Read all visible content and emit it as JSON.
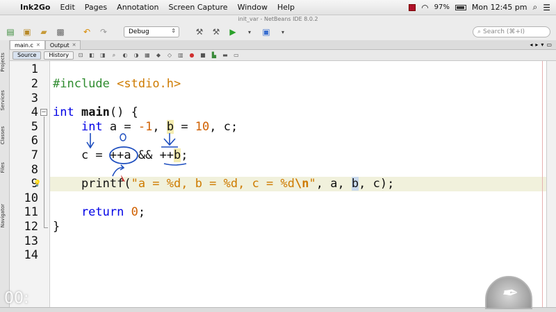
{
  "menubar": {
    "app_name": "Ink2Go",
    "items": [
      "Edit",
      "Pages",
      "Annotation",
      "Screen Capture",
      "Window",
      "Help"
    ],
    "battery": "97%",
    "clock": "Mon 12:45 pm"
  },
  "window": {
    "title": "init_var - NetBeans IDE 8.0.2"
  },
  "toolbar": {
    "config_value": "Debug",
    "search_placeholder": "Search (⌘+I)"
  },
  "sidebar": {
    "tabs": [
      "Projects",
      "Services",
      "Classes",
      "Files",
      "Navigator"
    ]
  },
  "editor_tabs": [
    {
      "label": "main.c"
    },
    {
      "label": "Output"
    }
  ],
  "subbar": {
    "source_label": "Source",
    "history_label": "History"
  },
  "line_numbers": [
    "1",
    "2",
    "3",
    "4",
    "5",
    "6",
    "7",
    "8",
    "9",
    "10",
    "11",
    "12",
    "13",
    "14"
  ],
  "code": {
    "line2": {
      "directive": "#include",
      "header": "<stdio.h>"
    },
    "line4": {
      "kw": "int",
      "name": "main",
      "rest": "() {"
    },
    "line5": {
      "indent": "    ",
      "kw": "int",
      "a": " a = ",
      "neg": "-1",
      "comma": ", ",
      "b": "b",
      "eq": " = ",
      "ten": "10",
      "tail": ", c;"
    },
    "line7": {
      "text1": "    c = ",
      "inc_a": "++a",
      "and": " && ",
      "inc_b": "++",
      "b": "b",
      "end": ";"
    },
    "line9": {
      "fn": "    printf(",
      "str1": "\"a = %d, b = %d, c = %d",
      "esc": "\\n",
      "str2": "\"",
      "args1": ", a, ",
      "b": "b",
      "args2": ", c);"
    },
    "line11": {
      "kw": "    return ",
      "zero": "0",
      "end": ";"
    },
    "line12": {
      "text": "}"
    }
  },
  "timer": {
    "text": "00:"
  },
  "colors": {
    "keyword": "#0000e6",
    "preprocessor": "#2e8b2e",
    "string": "#ce7b00",
    "annotation": "#1f4fbf"
  }
}
